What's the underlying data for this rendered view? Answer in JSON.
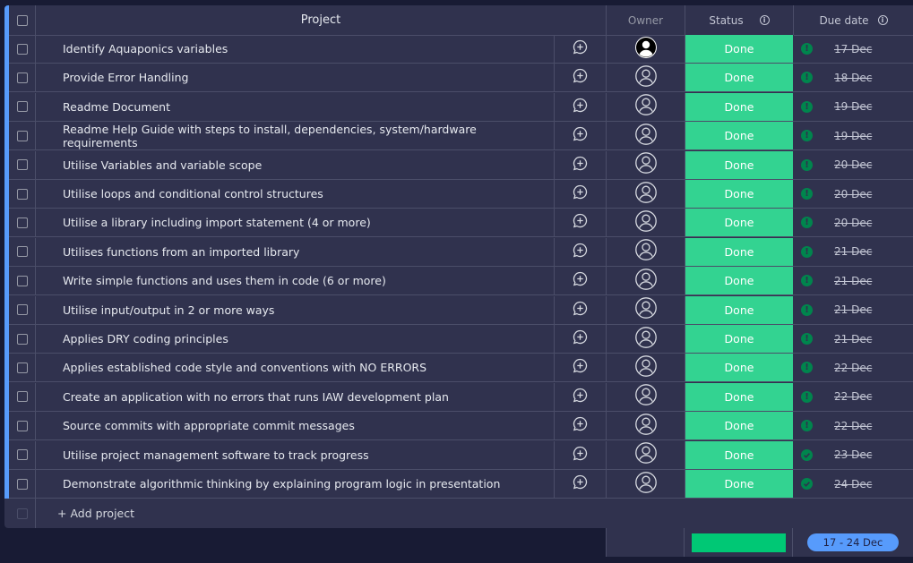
{
  "header": {
    "project_label": "Project",
    "owner_label": "Owner",
    "status_label": "Status",
    "due_label": "Due date"
  },
  "colors": {
    "accent": "#579bfc",
    "done": "#33d391",
    "summary_bar": "#00c875",
    "date_badge": "#579bfc"
  },
  "rows": [
    {
      "name": "Identify Aquaponics variables",
      "status": "Done",
      "due": "17 Dec",
      "owner": "avatar-filled-icon",
      "due_icon": "exclamation-icon"
    },
    {
      "name": "Provide Error Handling",
      "status": "Done",
      "due": "18 Dec",
      "owner": "person-outline-icon",
      "due_icon": "exclamation-icon"
    },
    {
      "name": "Readme Document",
      "status": "Done",
      "due": "19 Dec",
      "owner": "person-outline-icon",
      "due_icon": "exclamation-icon"
    },
    {
      "name": "Readme Help Guide with steps to install, dependencies, system/hardware requirements",
      "status": "Done",
      "due": "19 Dec",
      "owner": "person-outline-icon",
      "due_icon": "exclamation-icon"
    },
    {
      "name": "Utilise Variables and variable scope",
      "status": "Done",
      "due": "20 Dec",
      "owner": "person-outline-icon",
      "due_icon": "exclamation-icon"
    },
    {
      "name": "Utilise loops and conditional control structures",
      "status": "Done",
      "due": "20 Dec",
      "owner": "person-outline-icon",
      "due_icon": "exclamation-icon"
    },
    {
      "name": "Utilise a library including import statement (4 or more)",
      "status": "Done",
      "due": "20 Dec",
      "owner": "person-outline-icon",
      "due_icon": "exclamation-icon"
    },
    {
      "name": "Utilises functions from an imported library",
      "status": "Done",
      "due": "21 Dec",
      "owner": "person-outline-icon",
      "due_icon": "exclamation-icon"
    },
    {
      "name": "Write simple functions and uses them in code (6 or more)",
      "status": "Done",
      "due": "21 Dec",
      "owner": "person-outline-icon",
      "due_icon": "exclamation-icon"
    },
    {
      "name": "Utilise input/output in 2 or more ways",
      "status": "Done",
      "due": "21 Dec",
      "owner": "person-outline-icon",
      "due_icon": "exclamation-icon"
    },
    {
      "name": "Applies DRY coding principles",
      "status": "Done",
      "due": "21 Dec",
      "owner": "person-outline-icon",
      "due_icon": "exclamation-icon"
    },
    {
      "name": "Applies established code style and conventions with NO ERRORS",
      "status": "Done",
      "due": "22 Dec",
      "owner": "person-outline-icon",
      "due_icon": "exclamation-icon"
    },
    {
      "name": "Create an application with no errors that runs IAW development plan",
      "status": "Done",
      "due": "22 Dec",
      "owner": "person-outline-icon",
      "due_icon": "exclamation-icon"
    },
    {
      "name": "Source commits with appropriate commit messages",
      "status": "Done",
      "due": "22 Dec",
      "owner": "person-outline-icon",
      "due_icon": "exclamation-icon"
    },
    {
      "name": "Utilise project management software to track progress",
      "status": "Done",
      "due": "23 Dec",
      "owner": "person-outline-icon",
      "due_icon": "check-icon"
    },
    {
      "name": "Demonstrate algorithmic thinking by explaining program logic in presentation",
      "status": "Done",
      "due": "24 Dec",
      "owner": "person-outline-icon",
      "due_icon": "check-icon"
    }
  ],
  "add_row": {
    "label": "+ Add project"
  },
  "summary": {
    "status_done_fraction": 1.0,
    "date_range": "17 - 24 Dec"
  }
}
